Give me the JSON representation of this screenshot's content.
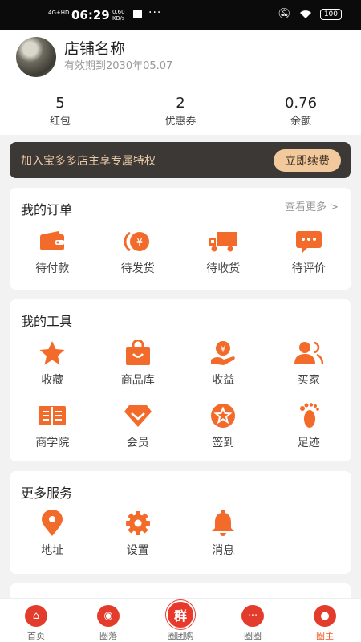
{
  "status_bar": {
    "network": "4G+HD",
    "time": "06:29",
    "speed": "0.60\nKB/s",
    "more": "···",
    "battery": "100"
  },
  "profile": {
    "shop_name": "店铺名称",
    "valid_until": "有效期到2030年05.07"
  },
  "stats": [
    {
      "value": "5",
      "label": "红包"
    },
    {
      "value": "2",
      "label": "优惠券"
    },
    {
      "value": "0.76",
      "label": "余额"
    }
  ],
  "vip_banner": {
    "text": "加入宝多多店主享专属特权",
    "button": "立即续费"
  },
  "orders": {
    "title": "我的订单",
    "more": "查看更多 >",
    "items": [
      {
        "label": "待付款",
        "icon": "wallet-icon"
      },
      {
        "label": "待发货",
        "icon": "yen-coin-icon"
      },
      {
        "label": "待收货",
        "icon": "truck-icon"
      },
      {
        "label": "待评价",
        "icon": "comment-icon"
      }
    ]
  },
  "tools": {
    "title": "我的工具",
    "items": [
      {
        "label": "收藏",
        "icon": "star-icon"
      },
      {
        "label": "商品库",
        "icon": "shopping-bag-icon"
      },
      {
        "label": "收益",
        "icon": "income-hand-icon"
      },
      {
        "label": "买家",
        "icon": "users-icon"
      },
      {
        "label": "商学院",
        "icon": "book-icon"
      },
      {
        "label": "会员",
        "icon": "diamond-icon"
      },
      {
        "label": "签到",
        "icon": "star-badge-icon"
      },
      {
        "label": "足迹",
        "icon": "footprint-icon"
      }
    ]
  },
  "services": {
    "title": "更多服务",
    "items": [
      {
        "label": "地址",
        "icon": "location-pin-icon"
      },
      {
        "label": "设置",
        "icon": "gear-icon"
      },
      {
        "label": "消息",
        "icon": "bell-icon"
      }
    ]
  },
  "tabbar": [
    {
      "label": "首页",
      "icon": "home-icon",
      "glyph": "⌂"
    },
    {
      "label": "圈落",
      "icon": "camera-icon",
      "glyph": "◉"
    },
    {
      "label": "圈团购",
      "icon": "group-buy-icon",
      "glyph": "群"
    },
    {
      "label": "圈圈",
      "icon": "chat-icon",
      "glyph": "···"
    },
    {
      "label": "圈主",
      "icon": "profile-icon",
      "glyph": "●"
    }
  ],
  "colors": {
    "accent": "#ee5a24",
    "icon_orange": "#f26b2a",
    "vip_bg": "#3b3835",
    "vip_text": "#e8c9a5",
    "vip_button": "#f2c99c",
    "tab_red": "#e43c2c"
  }
}
